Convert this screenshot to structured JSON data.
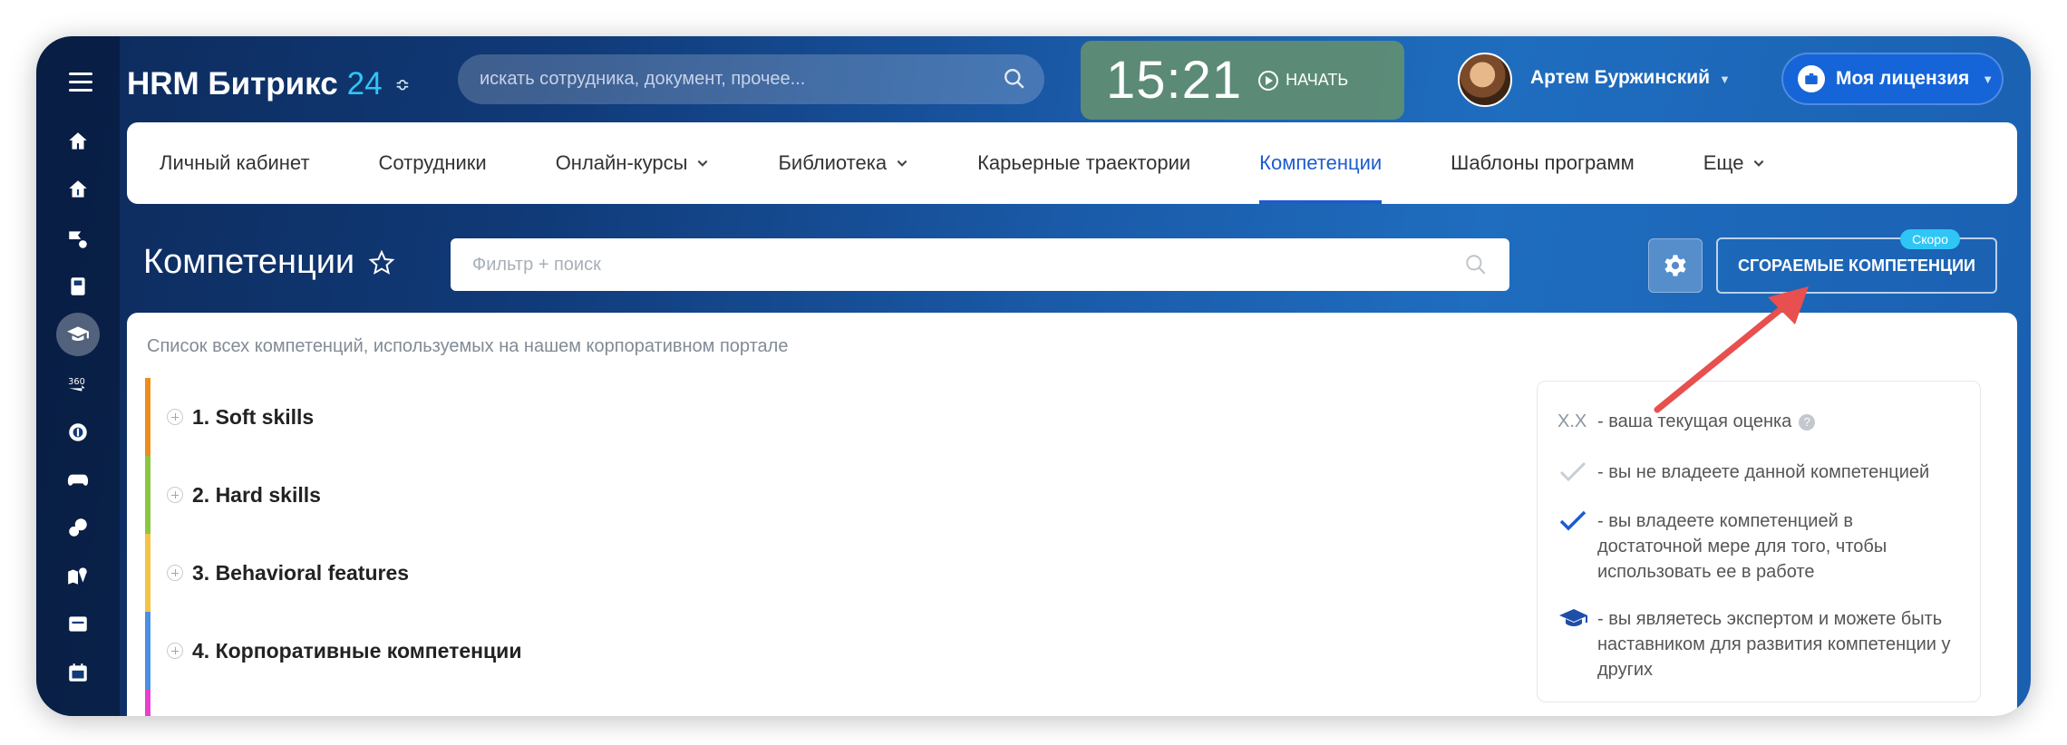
{
  "header": {
    "logo_text": "HRM Битрикс",
    "logo_num": "24",
    "search_placeholder": "искать сотрудника, документ, прочее...",
    "clock_time": "15:21",
    "clock_start": "НАЧАТЬ",
    "user_name": "Артем Буржинский",
    "license_label": "Моя лицензия"
  },
  "nav": {
    "items": [
      {
        "label": "Личный кабинет"
      },
      {
        "label": "Сотрудники"
      },
      {
        "label": "Онлайн-курсы"
      },
      {
        "label": "Библиотека"
      },
      {
        "label": "Карьерные траектории"
      },
      {
        "label": "Компетенции"
      },
      {
        "label": "Шаблоны программ"
      },
      {
        "label": "Еще"
      }
    ],
    "active": "Компетенции"
  },
  "page": {
    "title": "Компетенции",
    "filter_placeholder": "Фильтр + поиск",
    "burn_button": "СГОРАЕМЫЕ КОМПЕТЕНЦИИ",
    "soon_badge": "Скоро",
    "description": "Список всех компетенций, используемых на нашем корпоративном портале"
  },
  "competencies": [
    {
      "label": "1. Soft skills",
      "color": "#f08c1a"
    },
    {
      "label": "2. Hard skills",
      "color": "#8cc63f"
    },
    {
      "label": "3. Behavioral features",
      "color": "#f5c242"
    },
    {
      "label": "4. Корпоративные компетенции",
      "color": "#4a90e2"
    }
  ],
  "legend": {
    "score_key": "X.X",
    "score_text": "- ваша текущая оценка",
    "not_own": "- вы не владеете данной компетенцией",
    "own": "- вы владеете компетенцией в достаточной мере для того, чтобы использовать ее в работе",
    "expert": "- вы являетесь экспертом и можете быть наставником для развития компетенции у других"
  },
  "colors": {
    "accent": "#1e5bd1",
    "arrow": "#e84f4f",
    "clock_bg": "#64916e",
    "soon": "#2fc6f6"
  }
}
